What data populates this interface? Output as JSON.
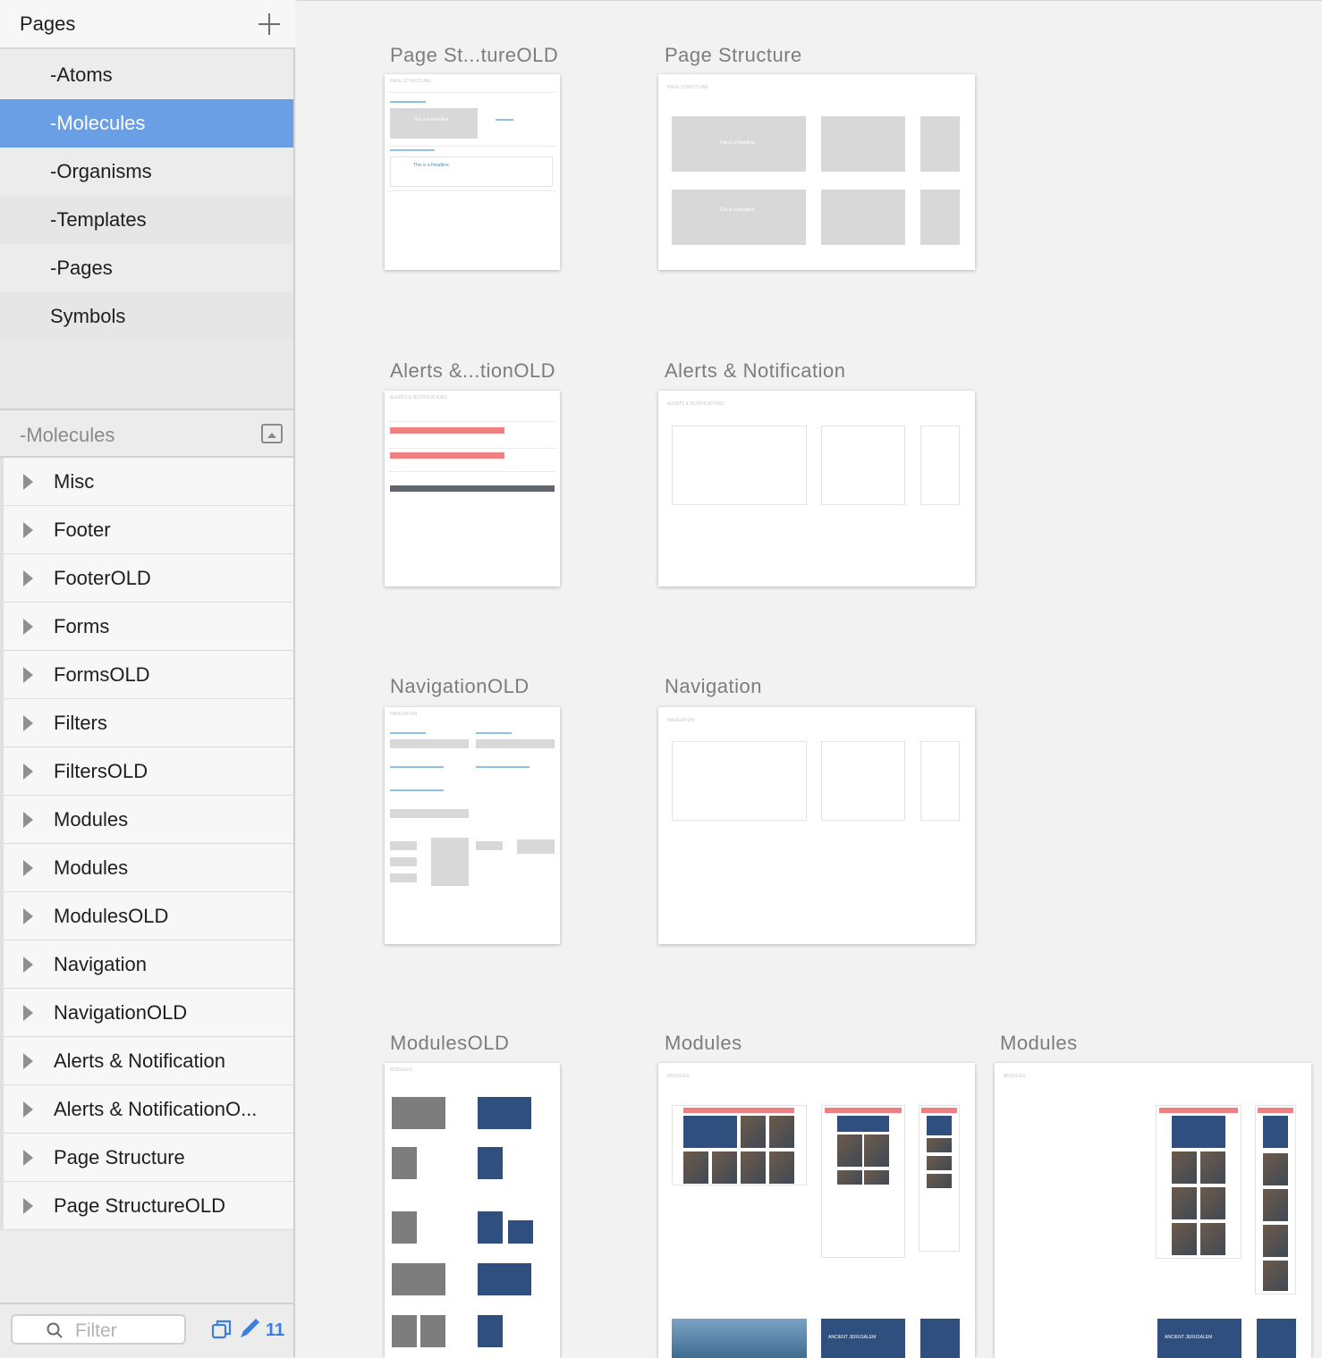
{
  "sidebar": {
    "pages_header": {
      "title": "Pages"
    },
    "pages": [
      {
        "label": "-Atoms"
      },
      {
        "label": "-Molecules"
      },
      {
        "label": "-Organisms"
      },
      {
        "label": "-Templates"
      },
      {
        "label": "-Pages"
      },
      {
        "label": "Symbols"
      }
    ],
    "selected_page": "-Molecules",
    "layers_header": {
      "title": "-Molecules"
    },
    "layers": [
      {
        "label": "Misc"
      },
      {
        "label": "Footer"
      },
      {
        "label": "FooterOLD"
      },
      {
        "label": "Forms"
      },
      {
        "label": "FormsOLD"
      },
      {
        "label": "Filters"
      },
      {
        "label": "FiltersOLD"
      },
      {
        "label": "Modules"
      },
      {
        "label": "Modules"
      },
      {
        "label": "ModulesOLD"
      },
      {
        "label": "Navigation"
      },
      {
        "label": "NavigationOLD"
      },
      {
        "label": "Alerts & Notification"
      },
      {
        "label": "Alerts & NotificationO..."
      },
      {
        "label": "Page Structure"
      },
      {
        "label": "Page StructureOLD"
      }
    ],
    "footer": {
      "filter_placeholder": "Filter",
      "selection_count": "11"
    }
  },
  "canvas": {
    "artboards": [
      {
        "title": "Page St...tureOLD",
        "caption": "PAGE STRUCTURE",
        "headline": "This is a Headline"
      },
      {
        "title": "Page Structure",
        "caption": "PAGE STRUCTURE",
        "headline": "This is a Headline"
      },
      {
        "title": "Alerts &...tionOLD",
        "caption": "ALERTS & NOTIFICATIONS"
      },
      {
        "title": "Alerts & Notification",
        "caption": "ALERTS & NOTIFICATIONS"
      },
      {
        "title": "NavigationOLD",
        "caption": "NAVIGATION"
      },
      {
        "title": "Navigation",
        "caption": "NAVIGATION"
      },
      {
        "title": "ModulesOLD",
        "caption": "MODULES"
      },
      {
        "title": "Modules",
        "caption": "MODULES",
        "feature_text": "ANCIENT JERUSALEM"
      },
      {
        "title": "Modules",
        "caption": "MODULES",
        "feature_text": "ANCIENT JERUSALEM"
      }
    ]
  },
  "colors": {
    "selection": "#6a9ee5",
    "count_badge": "#3a7fe0",
    "alert_red": "#f08080",
    "module_blue": "#2f4f7e"
  },
  "icons": {
    "add_page": "plus-icon",
    "collapse": "collapse-icon",
    "disclosure": "disclosure-triangle-icon",
    "filter": "search-icon",
    "copy": "copy-icon",
    "edit": "pencil-icon"
  }
}
